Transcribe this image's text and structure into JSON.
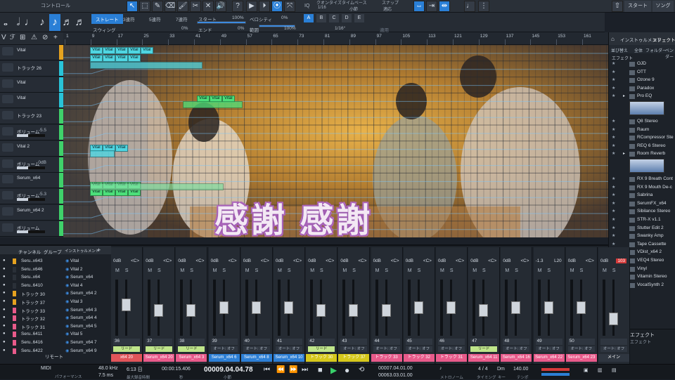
{
  "toolbar": {
    "control_label": "コントロール",
    "quantize": "クオンタイズ",
    "quantize_val": "1/16",
    "timebase": "タイムベース",
    "timebase_val": "小節",
    "snap": "スナップ",
    "snap_val": "適応",
    "iq": "IQ",
    "start": "スタート",
    "song": "ソング"
  },
  "qbar": {
    "straight": "ストレート",
    "triplet": "3連符",
    "quintuplet": "5連符",
    "septuplet": "7連符",
    "start": "スタート",
    "start_val": "100%",
    "velocity": "ベロシティ",
    "velocity_val": "0%",
    "swing": "スウィング",
    "swing_val": "0%",
    "end": "エンド",
    "end_val": "0%",
    "range": "範囲",
    "range_val": "100%",
    "letters": [
      "A",
      "B",
      "C",
      "D",
      "E"
    ],
    "grid_val": "1/16°",
    "apply": "適用"
  },
  "ruler": [
    "1",
    "9",
    "17",
    "25",
    "33",
    "41",
    "49",
    "57",
    "65",
    "73",
    "81",
    "89",
    "97",
    "105",
    "113",
    "121",
    "129",
    "137",
    "145",
    "153",
    "161",
    "169"
  ],
  "tracks": [
    {
      "name": "Vital",
      "value": "",
      "color": "#e5a21f",
      "type": "inst"
    },
    {
      "name": "トラック 26",
      "value": "",
      "color": "#29c3d8",
      "type": "inst"
    },
    {
      "name": "Vital",
      "value": "",
      "color": "#29c3d8",
      "type": "inst"
    },
    {
      "name": "Vital",
      "value": "",
      "color": "#29c3d8",
      "type": "inst"
    },
    {
      "name": "トラック 23",
      "value": "",
      "color": "#3fd16a",
      "type": "inst"
    },
    {
      "name": "ボリューム",
      "value": "-5.5",
      "color": "#3fd16a",
      "type": "vol"
    },
    {
      "name": "Vital 2",
      "value": "",
      "color": "#3fd16a",
      "type": "inst"
    },
    {
      "name": "ボリューム",
      "value": "0dB",
      "color": "#3fd16a",
      "type": "vol"
    },
    {
      "name": "Serum_x64",
      "value": "",
      "color": "#3fd16a",
      "type": "inst"
    },
    {
      "name": "ボリューム",
      "value": "-5.3",
      "color": "#3fd16a",
      "type": "vol"
    },
    {
      "name": "Serum_x64 2",
      "value": "",
      "color": "#3fd16a",
      "type": "inst"
    },
    {
      "name": "ボリューム",
      "value": "",
      "color": "#3fd16a",
      "type": "vol"
    }
  ],
  "clip_label": "Vital",
  "lyric": "感謝 感謝",
  "browser": {
    "tab_instruments": "インストゥルメント",
    "tab_effects": "エフェクト",
    "sort": "並び替え",
    "all": "全体",
    "folder": "フォルダー",
    "vendor": "ベンダー",
    "effect_label": "エフェクト",
    "items": [
      {
        "name": "OJD",
        "t": "fx"
      },
      {
        "name": "OTT",
        "t": "fx"
      },
      {
        "name": "Ozone 9",
        "t": "fx"
      },
      {
        "name": "Paradox",
        "t": "fx"
      },
      {
        "name": "Pro EQ",
        "t": "fxs"
      },
      {
        "name": "",
        "t": "thumb"
      },
      {
        "name": "Q8 Stereo",
        "t": "fx"
      },
      {
        "name": "Raum",
        "t": "fx"
      },
      {
        "name": "RCompressor Ste",
        "t": "fx"
      },
      {
        "name": "REQ 6 Stereo",
        "t": "fx"
      },
      {
        "name": "Room Reverb",
        "t": "fxs"
      },
      {
        "name": "",
        "t": "thumb"
      },
      {
        "name": "RX 9 Breath Cont",
        "t": "fx"
      },
      {
        "name": "RX 9 Mouth De-c",
        "t": "fx"
      },
      {
        "name": "Sabrina",
        "t": "fx"
      },
      {
        "name": "SerumFX_x64",
        "t": "fx"
      },
      {
        "name": "Sibilance Stereo",
        "t": "fx"
      },
      {
        "name": "STR-X v1.1",
        "t": "fx"
      },
      {
        "name": "Stutter Edit 2",
        "t": "fx"
      },
      {
        "name": "Swanky Amp",
        "t": "fx"
      },
      {
        "name": "Tape Cassette",
        "t": "fx"
      },
      {
        "name": "VDist_x64 2",
        "t": "fx"
      },
      {
        "name": "VEQ4 Stereo",
        "t": "fx"
      },
      {
        "name": "Vinyl",
        "t": "fx"
      },
      {
        "name": "Vitamin Stereo",
        "t": "fx"
      },
      {
        "name": "VocalSynth 2",
        "t": "fx"
      }
    ],
    "fx_title": "エフェクト",
    "fx_sub": "エフェクト"
  },
  "mixer": {
    "tab_channel": "チャンネル",
    "tab_group": "グループ",
    "tab_instrument": "インストゥルメント",
    "remote": "リモート",
    "channels": [
      {
        "name": "Seru..x643",
        "color": "#e5a21f"
      },
      {
        "name": "Seru..x646",
        "color": "#2a3038"
      },
      {
        "name": "Seru..x64",
        "color": "#2a3038"
      },
      {
        "name": "Seru..6410",
        "color": "#2a3038"
      },
      {
        "name": "トラック 30",
        "color": "#e5a21f"
      },
      {
        "name": "トラック 37",
        "color": "#e5a21f"
      },
      {
        "name": "トラック 33",
        "color": "#e85a8a"
      },
      {
        "name": "トラック 32",
        "color": "#e85a8a"
      },
      {
        "name": "トラック 31",
        "color": "#e85a8a"
      },
      {
        "name": "Seru..6411",
        "color": "#e85a8a"
      },
      {
        "name": "Seru..6416",
        "color": "#e85a8a"
      },
      {
        "name": "Seru..6422",
        "color": "#e85a8a"
      }
    ],
    "instruments": [
      "Vital",
      "Vital 2",
      "Serum_x64",
      "Vital 4",
      "Serum_x64 2",
      "Vital 3",
      "Serum_x64 3",
      "Serum_x64 4",
      "Serum_x64 5",
      "Vital 5",
      "Serum_x64 7",
      "Serum_x64 9"
    ],
    "strips": [
      {
        "db": "0dB",
        "pan": "<C>",
        "num": "36",
        "tag": "リード",
        "tagc": "#bfe58a",
        "cn": "x64 20",
        "cc": "#e0555a",
        "k": 0.55
      },
      {
        "db": "0dB",
        "pan": "<C>",
        "num": "37",
        "tag": "リード",
        "tagc": "#bfe58a",
        "cn": "Serum_x64 20",
        "cc": "#e85a8a",
        "k": 0.45
      },
      {
        "db": "0dB",
        "pan": "<C>",
        "num": "38",
        "tag": "リード",
        "tagc": "#bfe58a",
        "cn": "Serum_x64 3",
        "cc": "#e85a8a",
        "k": 0.45
      },
      {
        "db": "0dB",
        "pan": "<C>",
        "num": "39",
        "tag": "オート: オフ",
        "tagc": "#2f3640",
        "cn": "Serum_x64 6",
        "cc": "#2d7fd5",
        "k": 0.5
      },
      {
        "db": "0dB",
        "pan": "<C>",
        "num": "40",
        "tag": "オート: オフ",
        "tagc": "#2f3640",
        "cn": "Serum_x64 8",
        "cc": "#2d7fd5",
        "k": 0.5
      },
      {
        "db": "0dB",
        "pan": "<C>",
        "num": "41",
        "tag": "オート: オフ",
        "tagc": "#2f3640",
        "cn": "Serum_x64 10",
        "cc": "#2d7fd5",
        "k": 0.5
      },
      {
        "db": "0dB",
        "pan": "<C>",
        "num": "42",
        "tag": "リード",
        "tagc": "#bfe58a",
        "cn": "トラック 30",
        "cc": "#d6c81c",
        "k": 0.45
      },
      {
        "db": "0dB",
        "pan": "<C>",
        "num": "43",
        "tag": "オート: オフ",
        "tagc": "#2f3640",
        "cn": "トラック 37",
        "cc": "#d6c81c",
        "k": 0.45
      },
      {
        "db": "0dB",
        "pan": "<C>",
        "num": "44",
        "tag": "オート: オフ",
        "tagc": "#2f3640",
        "cn": "トラック 33",
        "cc": "#e85a8a",
        "k": 0.45
      },
      {
        "db": "0dB",
        "pan": "<C>",
        "num": "45",
        "tag": "オート: オフ",
        "tagc": "#2f3640",
        "cn": "トラック 32",
        "cc": "#e85a8a",
        "k": 0.5
      },
      {
        "db": "0dB",
        "pan": "<C>",
        "num": "46",
        "tag": "オート: オフ",
        "tagc": "#2f3640",
        "cn": "トラック 31",
        "cc": "#e85a8a",
        "k": 0.5
      },
      {
        "db": "0dB",
        "pan": "<C>",
        "num": "47",
        "tag": "リード",
        "tagc": "#bfe58a",
        "cn": "Serum_x64 11",
        "cc": "#e85a8a",
        "k": 0.45
      },
      {
        "db": "0dB",
        "pan": "<C>",
        "num": "48",
        "tag": "オート: オフ",
        "tagc": "#2f3640",
        "cn": "Serum_x64 16",
        "cc": "#e85a8a",
        "k": 0.5
      },
      {
        "db": "-1.3",
        "pan": "L20",
        "num": "49",
        "tag": "オート: オフ",
        "tagc": "#2f3640",
        "cn": "Serum_x64 22",
        "cc": "#e85a8a",
        "k": 0.5
      },
      {
        "db": "0dB",
        "pan": "<C>",
        "num": "50",
        "tag": "オート: オフ",
        "tagc": "#2f3640",
        "cn": "Serum_x64 23",
        "cc": "#e85a8a",
        "k": 0.5
      },
      {
        "db": "0dB",
        "pan": "103",
        "num": "",
        "tag": "オート: オフ",
        "tagc": "#2f3640",
        "cn": "メイン",
        "cc": "#2f3640",
        "k": 0.3
      }
    ]
  },
  "transport": {
    "midi": "MIDI",
    "performance": "パフォーマンス",
    "rate": "48.0 kHz",
    "latency": "7.5 ms",
    "duration": "6:13 日",
    "record": "最大録音時間",
    "time": "00:00:15.406",
    "time_sub": "秒",
    "bars": "00009.04.04.78",
    "bars_sub": "小節",
    "loop_l": "00007.04.01.00",
    "loop_r": "00063.03.01.00",
    "sig": "4 / 4",
    "key": "Dm",
    "tempo": "140.00",
    "metronome": "メトロノーム",
    "timecode": "タイミング",
    "key_label": "キー",
    "tempo_label": "テンポ"
  }
}
